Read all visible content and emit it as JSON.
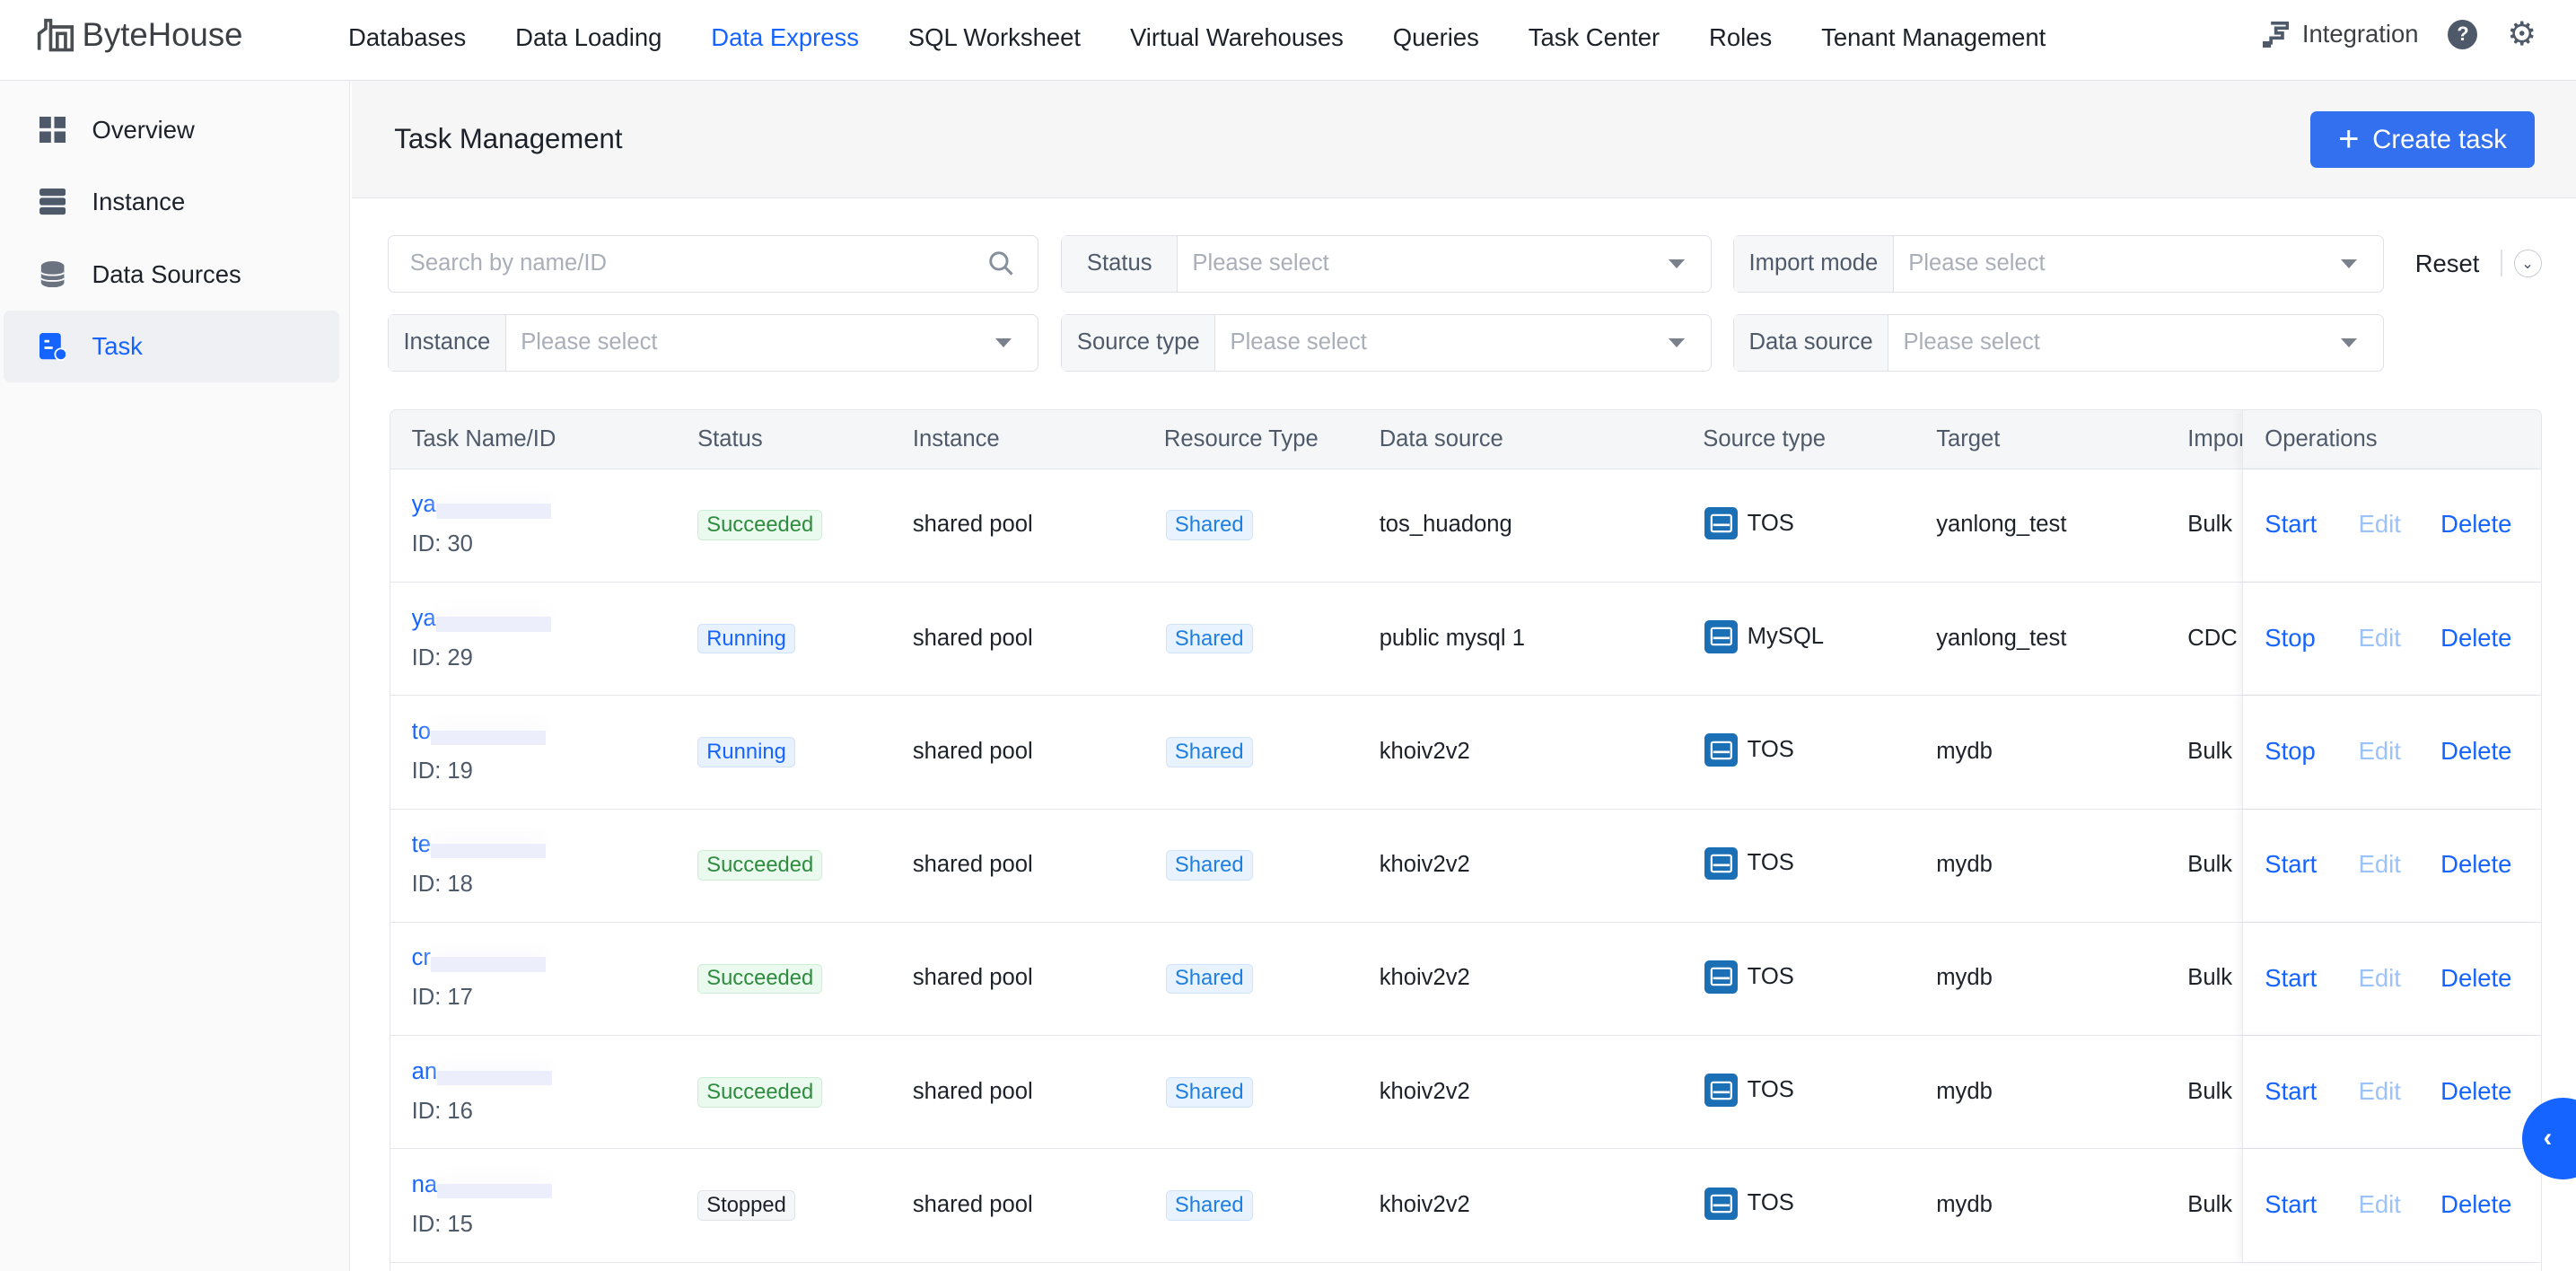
{
  "brand": {
    "name": "ByteHouse"
  },
  "nav": {
    "items": [
      "Databases",
      "Data Loading",
      "Data Express",
      "SQL Worksheet",
      "Virtual Warehouses",
      "Queries",
      "Task Center",
      "Roles",
      "Tenant Management"
    ],
    "active": "Data Express"
  },
  "topright": {
    "integration": "Integration"
  },
  "sidebar": {
    "items": [
      {
        "label": "Overview",
        "icon": "grid-icon"
      },
      {
        "label": "Instance",
        "icon": "server-icon"
      },
      {
        "label": "Data Sources",
        "icon": "database-icon"
      },
      {
        "label": "Task",
        "icon": "task-icon",
        "active": true
      }
    ]
  },
  "page": {
    "title": "Task Management",
    "create_label": "Create task"
  },
  "filters": {
    "search_placeholder": "Search by name/ID",
    "status_label": "Status",
    "import_mode_label": "Import mode",
    "instance_label": "Instance",
    "source_type_label": "Source type",
    "data_source_label": "Data source",
    "select_placeholder": "Please select",
    "reset": "Reset"
  },
  "table": {
    "columns": [
      "Task Name/ID",
      "Status",
      "Instance",
      "Resource Type",
      "Data source",
      "Source type",
      "Target",
      "Impor",
      "Operations"
    ],
    "rows": [
      {
        "name": "ya",
        "id": "ID: 30",
        "status": "Succeeded",
        "instance": "shared pool",
        "resource": "Shared",
        "data_source": "tos_huadong",
        "source_type": "TOS",
        "target": "yanlong_test",
        "import": "Bulk",
        "op1": "Start",
        "edit": "Edit",
        "delete": "Delete"
      },
      {
        "name": "ya",
        "id": "ID: 29",
        "status": "Running",
        "instance": "shared pool",
        "resource": "Shared",
        "data_source": "public mysql 1",
        "source_type": "MySQL",
        "target": "yanlong_test",
        "import": "CDC",
        "op1": "Stop",
        "edit": "Edit",
        "delete": "Delete"
      },
      {
        "name": "to",
        "id": "ID: 19",
        "status": "Running",
        "instance": "shared pool",
        "resource": "Shared",
        "data_source": "khoiv2v2",
        "source_type": "TOS",
        "target": "mydb",
        "import": "Bulk",
        "op1": "Stop",
        "edit": "Edit",
        "delete": "Delete"
      },
      {
        "name": "te",
        "id": "ID: 18",
        "status": "Succeeded",
        "instance": "shared pool",
        "resource": "Shared",
        "data_source": "khoiv2v2",
        "source_type": "TOS",
        "target": "mydb",
        "import": "Bulk",
        "op1": "Start",
        "edit": "Edit",
        "delete": "Delete"
      },
      {
        "name": "cr",
        "id": "ID: 17",
        "status": "Succeeded",
        "instance": "shared pool",
        "resource": "Shared",
        "data_source": "khoiv2v2",
        "source_type": "TOS",
        "target": "mydb",
        "import": "Bulk",
        "op1": "Start",
        "edit": "Edit",
        "delete": "Delete"
      },
      {
        "name": "an",
        "id": "ID: 16",
        "status": "Succeeded",
        "instance": "shared pool",
        "resource": "Shared",
        "data_source": "khoiv2v2",
        "source_type": "TOS",
        "target": "mydb",
        "import": "Bulk",
        "op1": "Start",
        "edit": "Edit",
        "delete": "Delete"
      },
      {
        "name": "na",
        "id": "ID: 15",
        "status": "Stopped",
        "instance": "shared pool",
        "resource": "Shared",
        "data_source": "khoiv2v2",
        "source_type": "TOS",
        "target": "mydb",
        "import": "Bulk",
        "op1": "Start",
        "edit": "Edit",
        "delete": "Delete"
      }
    ]
  },
  "colors": {
    "accent": "#1664ff",
    "success": "#2e8c3e",
    "button": "#3370f0"
  }
}
